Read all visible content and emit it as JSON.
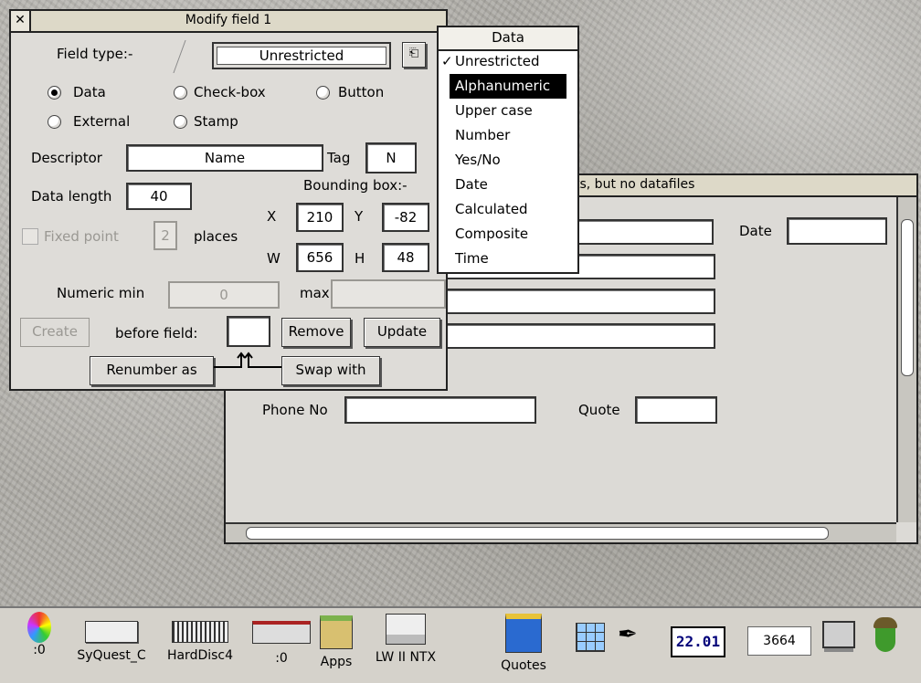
{
  "colors": {
    "window_bg": "#dedcd8",
    "titlebar": "#ddd9c8",
    "selection": "#000000"
  },
  "modify_window": {
    "title": "Modify field 1",
    "field_type_label": "Field type:-",
    "field_type_value": "Unrestricted",
    "radios": [
      {
        "label": "Data",
        "selected": true
      },
      {
        "label": "Check-box",
        "selected": false
      },
      {
        "label": "Button",
        "selected": false
      },
      {
        "label": "External",
        "selected": false
      },
      {
        "label": "Stamp",
        "selected": false
      }
    ],
    "descriptor_label": "Descriptor",
    "descriptor_value": "Name",
    "tag_label": "Tag",
    "tag_value": "N",
    "data_length_label": "Data length",
    "data_length_value": "40",
    "bounding_box_label": "Bounding box:-",
    "bbox": {
      "x_label": "X",
      "x": "210",
      "y_label": "Y",
      "y": "-82",
      "w_label": "W",
      "w": "656",
      "h_label": "H",
      "h": "48"
    },
    "fixed_point_label": "Fixed point",
    "places_value": "2",
    "places_label": "places",
    "numeric_min_label": "Numeric min",
    "numeric_min_value": "0",
    "max_label": "max",
    "max_value": "",
    "create_button": "Create",
    "before_field_label": "before field:",
    "before_field_value": "",
    "remove_button": "Remove",
    "update_button": "Update",
    "renumber_button": "Renumber as",
    "swap_button": "Swap with"
  },
  "data_menu": {
    "title": "Data",
    "items": [
      {
        "label": "Unrestricted",
        "checked": true,
        "highlighted": false
      },
      {
        "label": "Alphanumeric",
        "checked": false,
        "highlighted": true
      },
      {
        "label": "Upper case",
        "checked": false,
        "highlighted": false
      },
      {
        "label": "Number",
        "checked": false,
        "highlighted": false
      },
      {
        "label": "Yes/No",
        "checked": false,
        "highlighted": false
      },
      {
        "label": "Date",
        "checked": false,
        "highlighted": false
      },
      {
        "label": "Calculated",
        "checked": false,
        "highlighted": false
      },
      {
        "label": "Composite",
        "checked": false,
        "highlighted": false
      },
      {
        "label": "Time",
        "checked": false,
        "highlighted": false
      }
    ]
  },
  "card_window": {
    "title_fragment": "ts, but no datafiles",
    "date_label": "Date",
    "phone_label": "Phone No",
    "quote_label": "Quote"
  },
  "iconbar": {
    "items": [
      {
        "label": ":0",
        "icon": "cd-icon"
      },
      {
        "label": "SyQuest_C",
        "icon": "drive-icon"
      },
      {
        "label": "HardDisc4",
        "icon": "harddisc-icon"
      },
      {
        "label": ":0",
        "icon": "floppy-icon"
      },
      {
        "label": "Apps",
        "icon": "apps-icon"
      },
      {
        "label": "LW II NTX",
        "icon": "printer-icon"
      },
      {
        "label": "Quotes",
        "icon": "folder-chart-icon"
      }
    ],
    "clock": "22.01",
    "memory": "3664"
  }
}
